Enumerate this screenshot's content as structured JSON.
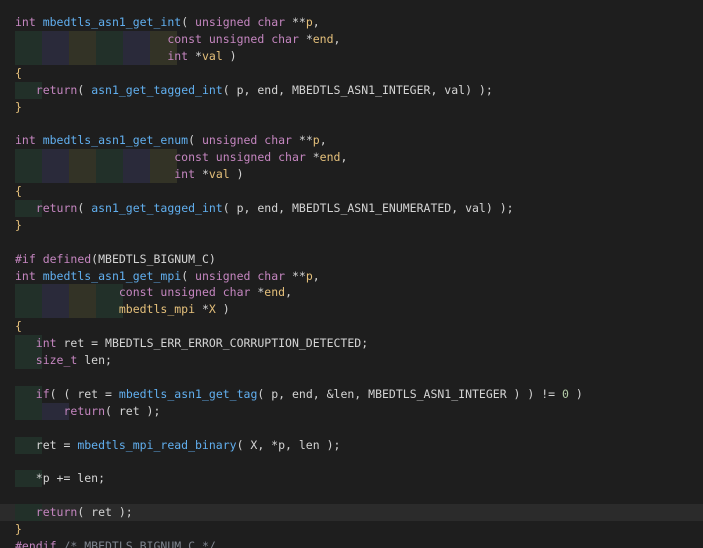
{
  "colors": {
    "background": "#1e1e1e",
    "highlight_line": "#2b2b2b",
    "guide_1": "#223029",
    "guide_2": "#2a2a3a",
    "guide_3": "#333326"
  },
  "code": {
    "lines": [
      [
        [
          "k",
          "int "
        ],
        [
          "f",
          "mbedtls_asn1_get_int"
        ],
        [
          "p",
          "( "
        ],
        [
          "k",
          "unsigned "
        ],
        [
          "k",
          "char "
        ],
        [
          "p",
          "**"
        ],
        [
          "v",
          "p"
        ],
        [
          "p",
          ","
        ]
      ],
      [
        [
          "p",
          "                      "
        ],
        [
          "k",
          "const "
        ],
        [
          "k",
          "unsigned "
        ],
        [
          "k",
          "char "
        ],
        [
          "p",
          "*"
        ],
        [
          "v",
          "end"
        ],
        [
          "p",
          ","
        ]
      ],
      [
        [
          "p",
          "                      "
        ],
        [
          "k",
          "int "
        ],
        [
          "p",
          "*"
        ],
        [
          "v",
          "val"
        ],
        [
          "p",
          " )"
        ]
      ],
      [
        [
          "b",
          "{"
        ]
      ],
      [
        [
          "p",
          "   "
        ],
        [
          "k",
          "return"
        ],
        [
          "p",
          "( "
        ],
        [
          "f",
          "asn1_get_tagged_int"
        ],
        [
          "p",
          "( p, end, MBEDTLS_ASN1_INTEGER, val) );"
        ]
      ],
      [
        [
          "b",
          "}"
        ]
      ],
      [],
      [
        [
          "k",
          "int "
        ],
        [
          "f",
          "mbedtls_asn1_get_enum"
        ],
        [
          "p",
          "( "
        ],
        [
          "k",
          "unsigned "
        ],
        [
          "k",
          "char "
        ],
        [
          "p",
          "**"
        ],
        [
          "v",
          "p"
        ],
        [
          "p",
          ","
        ]
      ],
      [
        [
          "p",
          "                       "
        ],
        [
          "k",
          "const "
        ],
        [
          "k",
          "unsigned "
        ],
        [
          "k",
          "char "
        ],
        [
          "p",
          "*"
        ],
        [
          "v",
          "end"
        ],
        [
          "p",
          ","
        ]
      ],
      [
        [
          "p",
          "                       "
        ],
        [
          "k",
          "int "
        ],
        [
          "p",
          "*"
        ],
        [
          "v",
          "val"
        ],
        [
          "p",
          " )"
        ]
      ],
      [
        [
          "b",
          "{"
        ]
      ],
      [
        [
          "p",
          "   "
        ],
        [
          "k",
          "return"
        ],
        [
          "p",
          "( "
        ],
        [
          "f",
          "asn1_get_tagged_int"
        ],
        [
          "p",
          "( p, end, MBEDTLS_ASN1_ENUMERATED, val) );"
        ]
      ],
      [
        [
          "b",
          "}"
        ]
      ],
      [],
      [
        [
          "k",
          "#if "
        ],
        [
          "k",
          "defined"
        ],
        [
          "p",
          "(MBEDTLS_BIGNUM_C)"
        ]
      ],
      [
        [
          "k",
          "int "
        ],
        [
          "f",
          "mbedtls_asn1_get_mpi"
        ],
        [
          "p",
          "( "
        ],
        [
          "k",
          "unsigned "
        ],
        [
          "k",
          "char "
        ],
        [
          "p",
          "**"
        ],
        [
          "v",
          "p"
        ],
        [
          "p",
          ","
        ]
      ],
      [
        [
          "p",
          "               "
        ],
        [
          "k",
          "const "
        ],
        [
          "k",
          "unsigned "
        ],
        [
          "k",
          "char "
        ],
        [
          "p",
          "*"
        ],
        [
          "v",
          "end"
        ],
        [
          "p",
          ","
        ]
      ],
      [
        [
          "p",
          "               "
        ],
        [
          "v",
          "mbedtls_mpi "
        ],
        [
          "p",
          "*"
        ],
        [
          "v",
          "X"
        ],
        [
          "p",
          " )"
        ]
      ],
      [
        [
          "b",
          "{"
        ]
      ],
      [
        [
          "p",
          "   "
        ],
        [
          "k",
          "int "
        ],
        [
          "p",
          "ret = MBEDTLS_ERR_ERROR_CORRUPTION_DETECTED;"
        ]
      ],
      [
        [
          "p",
          "   "
        ],
        [
          "k",
          "size_t "
        ],
        [
          "p",
          "len;"
        ]
      ],
      [],
      [
        [
          "p",
          "   "
        ],
        [
          "k",
          "if"
        ],
        [
          "p",
          "( ( ret = "
        ],
        [
          "f",
          "mbedtls_asn1_get_tag"
        ],
        [
          "p",
          "( p, end, &len, MBEDTLS_ASN1_INTEGER ) ) != "
        ],
        [
          "n",
          "0"
        ],
        [
          "p",
          " )"
        ]
      ],
      [
        [
          "p",
          "       "
        ],
        [
          "k",
          "return"
        ],
        [
          "p",
          "( ret );"
        ]
      ],
      [],
      [
        [
          "p",
          "   ret = "
        ],
        [
          "f",
          "mbedtls_mpi_read_binary"
        ],
        [
          "p",
          "( X, *p, len );"
        ]
      ],
      [],
      [
        [
          "p",
          "   *p += len;"
        ]
      ],
      [],
      [
        [
          "p",
          "   "
        ],
        [
          "k",
          "return"
        ],
        [
          "p",
          "( ret );"
        ]
      ],
      [
        [
          "b",
          "}"
        ]
      ],
      [
        [
          "k",
          "#endif "
        ],
        [
          "c",
          "/* MBEDTLS_BIGNUM_C */"
        ]
      ]
    ]
  }
}
